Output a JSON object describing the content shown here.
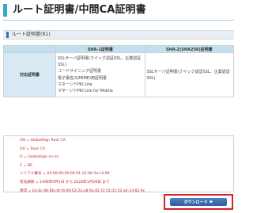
{
  "page": {
    "title": "ルート証明書/中間CA証明書"
  },
  "section": {
    "title": "ルート証明書(R1)"
  },
  "table": {
    "headers": [
      "",
      "SHA-1証明書",
      "SHA-2(SHA256)証明書"
    ],
    "row_label": "対応証明書",
    "sha1_uses": [
      "SSLサーバ証明書(クイック認証SSL、企業認証",
      "SSL)",
      "コードサイニング証明書",
      "電子署名(S/MIME)用証明書",
      "マネージドPKI Lite",
      "マネージドPKI Lite for Mobile"
    ],
    "sha2_uses": [
      "SSLサーバ証明書(クイック認証SSL、企業認証",
      "SSL)"
    ]
  },
  "details": {
    "cn": "CN = GlobalSign Root CA",
    "ou": "OU = Root CA",
    "o": "O = GlobalSign nv-sa",
    "c": "C = BE",
    "serial": "シリアル番号 = 04:00:00:00:00:01:15:4b:5a:c3:94",
    "validity": "有効期限 = 1998年9月1日 から 2028年1月28日 まで",
    "thumbprint": "拇印 = b1:bc:96:8b:d4:f4:9d:62:2a:a8:9a:81:f2:15:01:52:a4:1d:82:9c"
  },
  "download": {
    "label": "ダウンロード",
    "arrow_icon": "triangle-right"
  },
  "colors": {
    "accent": "#39a6cc",
    "detail_text": "#c1272d",
    "highlight": "#d0212c",
    "button": "#2c5e9c"
  }
}
